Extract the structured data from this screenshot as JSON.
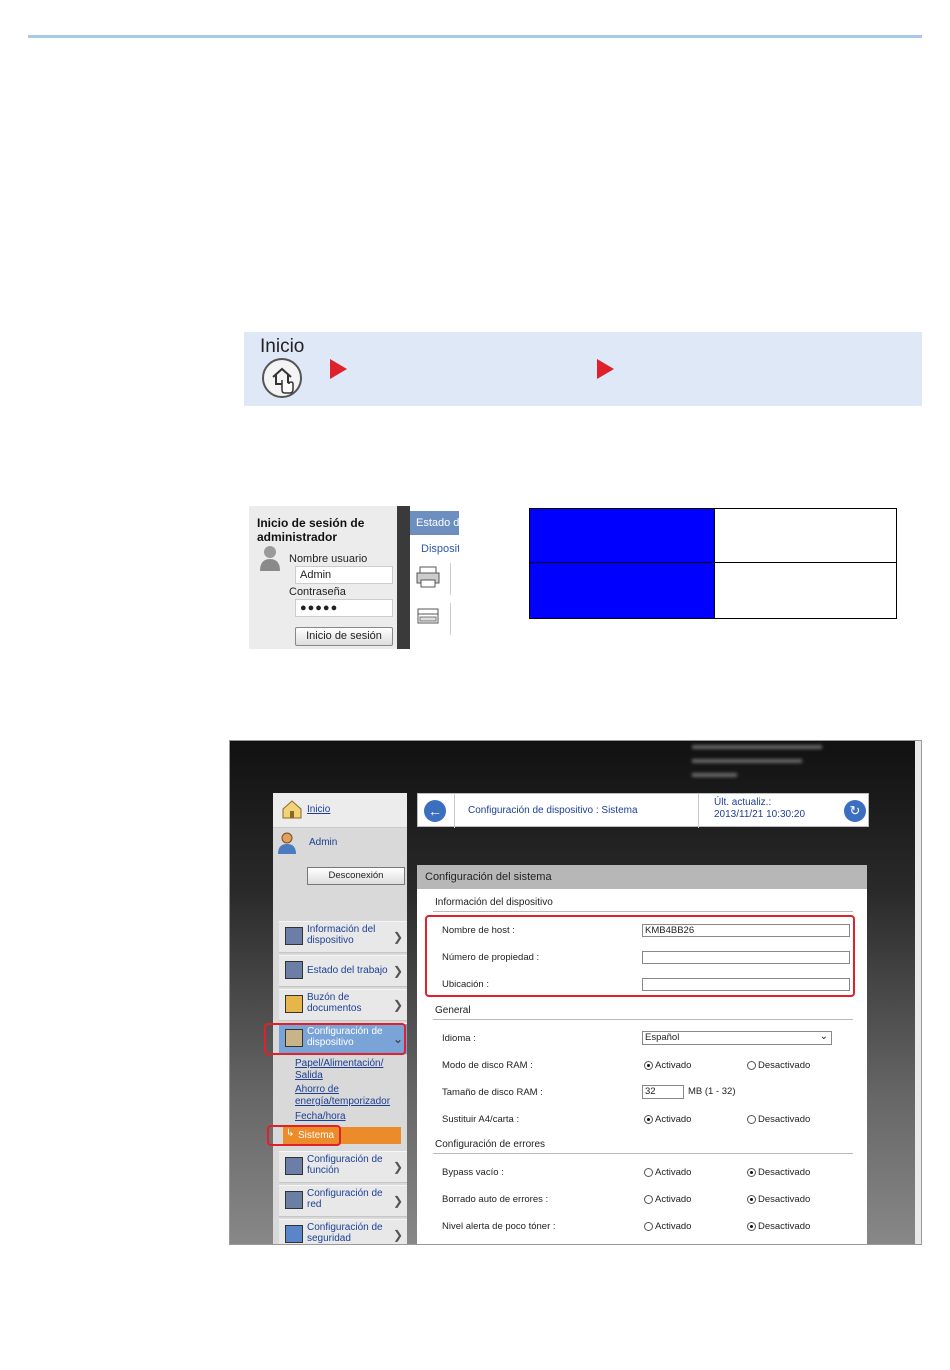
{
  "banner": {
    "inicio_label": "Inicio"
  },
  "login": {
    "title": "Inicio de sesión de administrador",
    "username_label": "Nombre usuario",
    "username_value": "Admin",
    "password_label": "Contraseña",
    "password_value": "●●●●●",
    "login_button": "Inicio de sesión",
    "tab_label": "Estado d",
    "sub_label": "Disposit"
  },
  "screenshot": {
    "nav": {
      "home": "Inicio",
      "user": "Admin",
      "logout": "Desconexión",
      "items": [
        {
          "label": "Información del dispositivo"
        },
        {
          "label": "Estado del trabajo"
        },
        {
          "label": "Buzón de documentos"
        },
        {
          "label": "Configuración de dispositivo"
        }
      ],
      "subitems": [
        "Papel/Alimentación/ Salida",
        "Ahorro de energía/temporizador",
        "Fecha/hora"
      ],
      "selected_subitem": "Sistema",
      "items2": [
        {
          "label": "Configuración de función"
        },
        {
          "label": "Configuración de red"
        },
        {
          "label": "Configuración de seguridad"
        }
      ]
    },
    "header": {
      "breadcrumb": "Configuración de dispositivo : Sistema",
      "updated_label": "Últ. actualiz.:",
      "updated_value": "2013/11/21 10:30:20"
    },
    "panel": {
      "title": "Configuración del sistema",
      "section_device": "Información del dispositivo",
      "hostname_label": "Nombre de host :",
      "hostname_value": "KMB4BB26",
      "asset_label": "Número de propiedad :",
      "location_label": "Ubicación :",
      "section_general": "General",
      "language_label": "Idioma :",
      "language_value": "Español",
      "ramdisk_label": "Modo de disco RAM :",
      "ramsize_label": "Tamaño de disco RAM :",
      "ramsize_value": "32",
      "ramsize_unit": "MB (1 - 32)",
      "a4_label": "Sustituir A4/carta :",
      "section_errors": "Configuración de errores",
      "bypass_label": "Bypass vacío :",
      "autoclear_label": "Borrado auto de errores :",
      "toner_label": "Nivel alerta de poco tóner :",
      "on": "Activado",
      "off": "Desactivado"
    }
  }
}
